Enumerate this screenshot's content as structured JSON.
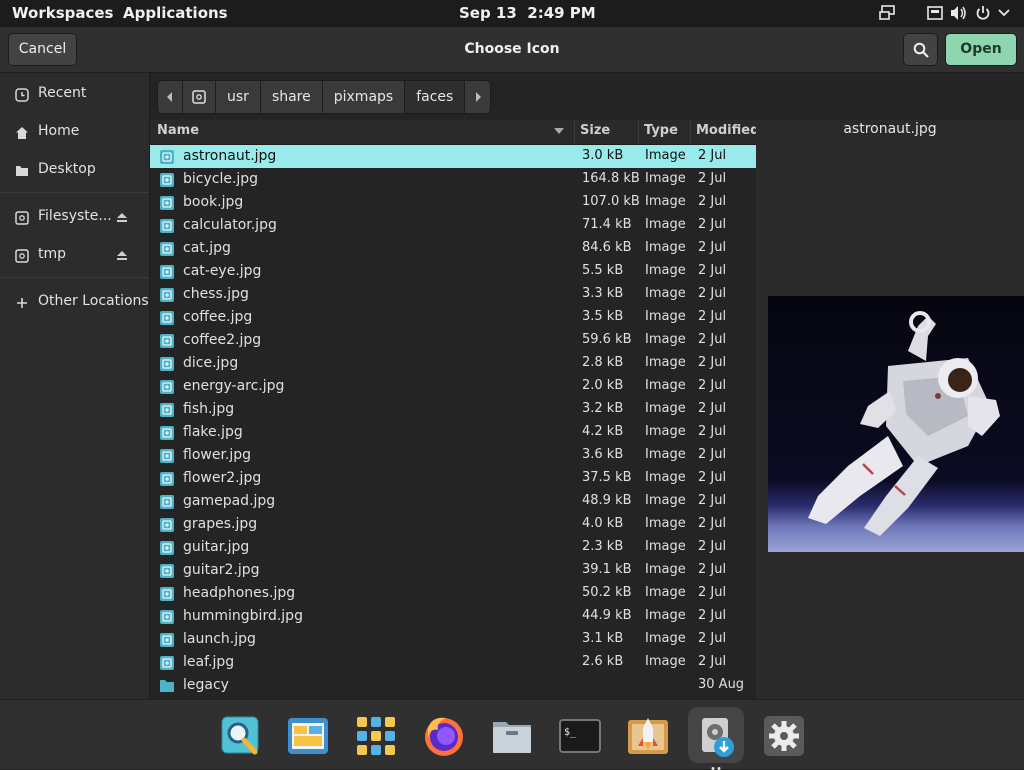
{
  "topbar": {
    "workspaces": "Workspaces",
    "applications": "Applications",
    "date": "Sep 13",
    "time": "2:49 PM",
    "icons": [
      "display-icon",
      "keyboard-icon",
      "volume-icon",
      "power-icon",
      "chevron-down-icon"
    ]
  },
  "dialog": {
    "title": "Choose Icon",
    "cancel_label": "Cancel",
    "open_label": "Open",
    "accent_color": "#8fd5b0"
  },
  "sidebar": {
    "items": [
      {
        "label": "Recent",
        "icon": "recent-icon"
      },
      {
        "label": "Home",
        "icon": "home-icon"
      },
      {
        "label": "Desktop",
        "icon": "desktop-icon"
      },
      {
        "label": "Filesyste...",
        "icon": "drive-icon",
        "ejectable": true
      },
      {
        "label": "tmp",
        "icon": "drive-icon",
        "ejectable": true
      },
      {
        "label": "Other Locations",
        "icon": "plus-icon"
      }
    ]
  },
  "pathbar": {
    "crumbs": [
      "usr",
      "share",
      "pixmaps",
      "faces"
    ],
    "active": "faces"
  },
  "columns": {
    "name": "Name",
    "size": "Size",
    "type": "Type",
    "modified": "Modified"
  },
  "files": [
    {
      "name": "astronaut.jpg",
      "size": "3.0 kB",
      "type": "Image",
      "modified": "2 Jul",
      "selected": true
    },
    {
      "name": "bicycle.jpg",
      "size": "164.8 kB",
      "type": "Image",
      "modified": "2 Jul"
    },
    {
      "name": "book.jpg",
      "size": "107.0 kB",
      "type": "Image",
      "modified": "2 Jul"
    },
    {
      "name": "calculator.jpg",
      "size": "71.4 kB",
      "type": "Image",
      "modified": "2 Jul"
    },
    {
      "name": "cat.jpg",
      "size": "84.6 kB",
      "type": "Image",
      "modified": "2 Jul"
    },
    {
      "name": "cat-eye.jpg",
      "size": "5.5 kB",
      "type": "Image",
      "modified": "2 Jul"
    },
    {
      "name": "chess.jpg",
      "size": "3.3 kB",
      "type": "Image",
      "modified": "2 Jul"
    },
    {
      "name": "coffee.jpg",
      "size": "3.5 kB",
      "type": "Image",
      "modified": "2 Jul"
    },
    {
      "name": "coffee2.jpg",
      "size": "59.6 kB",
      "type": "Image",
      "modified": "2 Jul"
    },
    {
      "name": "dice.jpg",
      "size": "2.8 kB",
      "type": "Image",
      "modified": "2 Jul"
    },
    {
      "name": "energy-arc.jpg",
      "size": "2.0 kB",
      "type": "Image",
      "modified": "2 Jul"
    },
    {
      "name": "fish.jpg",
      "size": "3.2 kB",
      "type": "Image",
      "modified": "2 Jul"
    },
    {
      "name": "flake.jpg",
      "size": "4.2 kB",
      "type": "Image",
      "modified": "2 Jul"
    },
    {
      "name": "flower.jpg",
      "size": "3.6 kB",
      "type": "Image",
      "modified": "2 Jul"
    },
    {
      "name": "flower2.jpg",
      "size": "37.5 kB",
      "type": "Image",
      "modified": "2 Jul"
    },
    {
      "name": "gamepad.jpg",
      "size": "48.9 kB",
      "type": "Image",
      "modified": "2 Jul"
    },
    {
      "name": "grapes.jpg",
      "size": "4.0 kB",
      "type": "Image",
      "modified": "2 Jul"
    },
    {
      "name": "guitar.jpg",
      "size": "2.3 kB",
      "type": "Image",
      "modified": "2 Jul"
    },
    {
      "name": "guitar2.jpg",
      "size": "39.1 kB",
      "type": "Image",
      "modified": "2 Jul"
    },
    {
      "name": "headphones.jpg",
      "size": "50.2 kB",
      "type": "Image",
      "modified": "2 Jul"
    },
    {
      "name": "hummingbird.jpg",
      "size": "44.9 kB",
      "type": "Image",
      "modified": "2 Jul"
    },
    {
      "name": "launch.jpg",
      "size": "3.1 kB",
      "type": "Image",
      "modified": "2 Jul"
    },
    {
      "name": "leaf.jpg",
      "size": "2.6 kB",
      "type": "Image",
      "modified": "2 Jul"
    },
    {
      "name": "legacy",
      "size": "",
      "type": "",
      "modified": "30 Aug",
      "is_folder": true
    }
  ],
  "preview": {
    "filename": "astronaut.jpg",
    "image": "astronaut-photo"
  },
  "dock": {
    "apps": [
      {
        "name": "search-app-icon"
      },
      {
        "name": "multitasking-app-icon"
      },
      {
        "name": "app-grid-icon"
      },
      {
        "name": "firefox-icon"
      },
      {
        "name": "files-icon"
      },
      {
        "name": "terminal-icon"
      },
      {
        "name": "app-launcher-icon"
      },
      {
        "name": "installer-icon",
        "running": true
      },
      {
        "name": "settings-icon"
      }
    ]
  }
}
